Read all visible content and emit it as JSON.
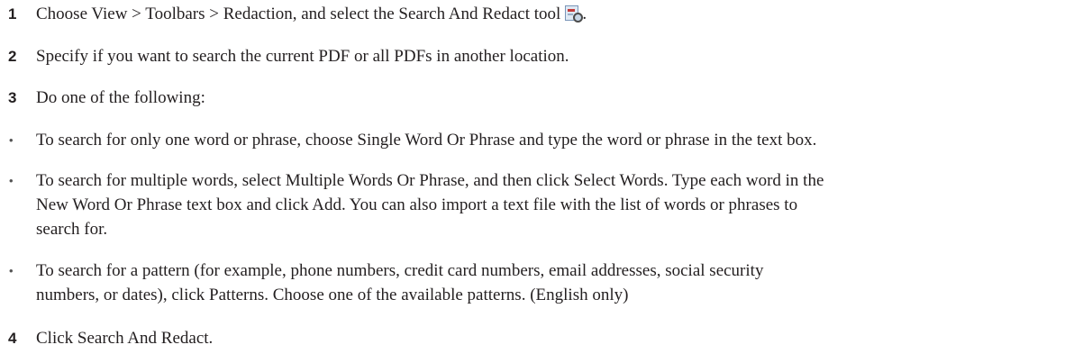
{
  "steps": [
    {
      "marker": "1",
      "text": "Choose View > Toolbars > Redaction, and select the Search And Redact tool",
      "trailing": ".",
      "icon": "search-and-redact-tool-icon"
    },
    {
      "marker": "2",
      "text": "Specify if you want to search the current PDF or all PDFs in another location."
    },
    {
      "marker": "3",
      "text": "Do one of the following:"
    },
    {
      "marker": "•",
      "lines": [
        "To search for only one word or phrase, choose Single Word Or Phrase and type the word or phrase in the text box."
      ]
    },
    {
      "marker": "•",
      "lines": [
        "To search for multiple words, select Multiple Words Or Phrase, and then click Select Words. Type each word in the",
        "New Word Or Phrase text box and click Add. You can also import a text file with the list of words or phrases to",
        "search for."
      ]
    },
    {
      "marker": "•",
      "lines": [
        "To search for a pattern (for example, phone numbers, credit card numbers, email addresses, social security",
        "numbers, or dates), click Patterns. Choose one of the available patterns. (English only)"
      ]
    },
    {
      "marker": "4",
      "text": "Click Search And Redact."
    }
  ]
}
